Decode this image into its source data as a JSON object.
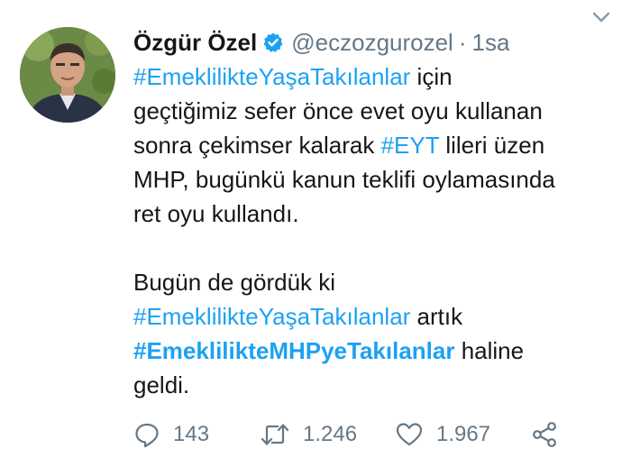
{
  "user": {
    "name": "Özgür Özel",
    "handle": "@eczozgurozel",
    "separator": "·",
    "time": "1sa"
  },
  "tweet": {
    "line1_tag": "#EmeklilikteYaşaTakılanlar",
    "line1_rest": " için",
    "line2": "geçtiğimiz sefer önce evet oyu kullanan",
    "line3_pre": "sonra çekimser kalarak ",
    "line3_tag": "#EYT",
    "line3_post": " lileri üzen",
    "line4": "MHP, bugünkü kanun teklifi oylamasında",
    "line5": "ret oyu kullandı.",
    "line6": "Bugün de gördük ki",
    "line7_tag": "#EmeklilikteYaşaTakılanlar",
    "line7_rest": " artık",
    "line8_tag": "#EmeklilikteMHPyeTakılanlar",
    "line8_rest": " haline",
    "line9": "geldi."
  },
  "actions": {
    "replies": "143",
    "retweets": "1.246",
    "likes": "1.967"
  },
  "icons": {
    "verified": "verified-badge-icon",
    "caret": "chevron-down-icon",
    "reply": "reply-icon",
    "retweet": "retweet-icon",
    "like": "heart-icon",
    "share": "share-icon"
  },
  "colors": {
    "link": "#1da1f2",
    "secondary": "#657786",
    "text": "#14171a"
  }
}
